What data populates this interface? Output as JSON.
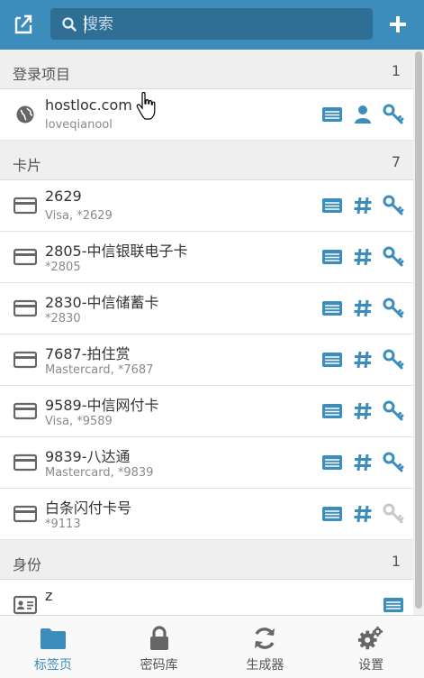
{
  "header": {
    "search_placeholder": "搜索",
    "colors": {
      "bar": "#3c8dbc",
      "search_bg": "#2f6f96"
    }
  },
  "sections": {
    "logins": {
      "title": "登录项目",
      "count": "1",
      "items": [
        {
          "name": "hostloc.com",
          "sub": "loveqianool"
        }
      ]
    },
    "cards": {
      "title": "卡片",
      "count": "7",
      "items": [
        {
          "name": "2629",
          "sub": "Visa, *2629"
        },
        {
          "name": "2805-中信银联电子卡",
          "sub": "*2805"
        },
        {
          "name": "2830-中信储蓄卡",
          "sub": "*2830"
        },
        {
          "name": "7687-拍住赏",
          "sub": "Mastercard, *7687"
        },
        {
          "name": "9589-中信网付卡",
          "sub": "Visa, *9589"
        },
        {
          "name": "9839-八达通",
          "sub": "Mastercard, *9839"
        },
        {
          "name": "白条闪付卡号",
          "sub": "*9113"
        }
      ]
    },
    "identities": {
      "title": "身份",
      "count": "1",
      "items": [
        {
          "name": "z",
          "sub": ""
        }
      ]
    }
  },
  "tabs": [
    {
      "label": "标签页",
      "icon": "folder-icon",
      "active": true
    },
    {
      "label": "密码库",
      "icon": "lock-icon",
      "active": false
    },
    {
      "label": "生成器",
      "icon": "refresh-icon",
      "active": false
    },
    {
      "label": "设置",
      "icon": "gear-icon",
      "active": false
    }
  ],
  "accent": "#3c8dbc",
  "icon_gray": "#666666"
}
